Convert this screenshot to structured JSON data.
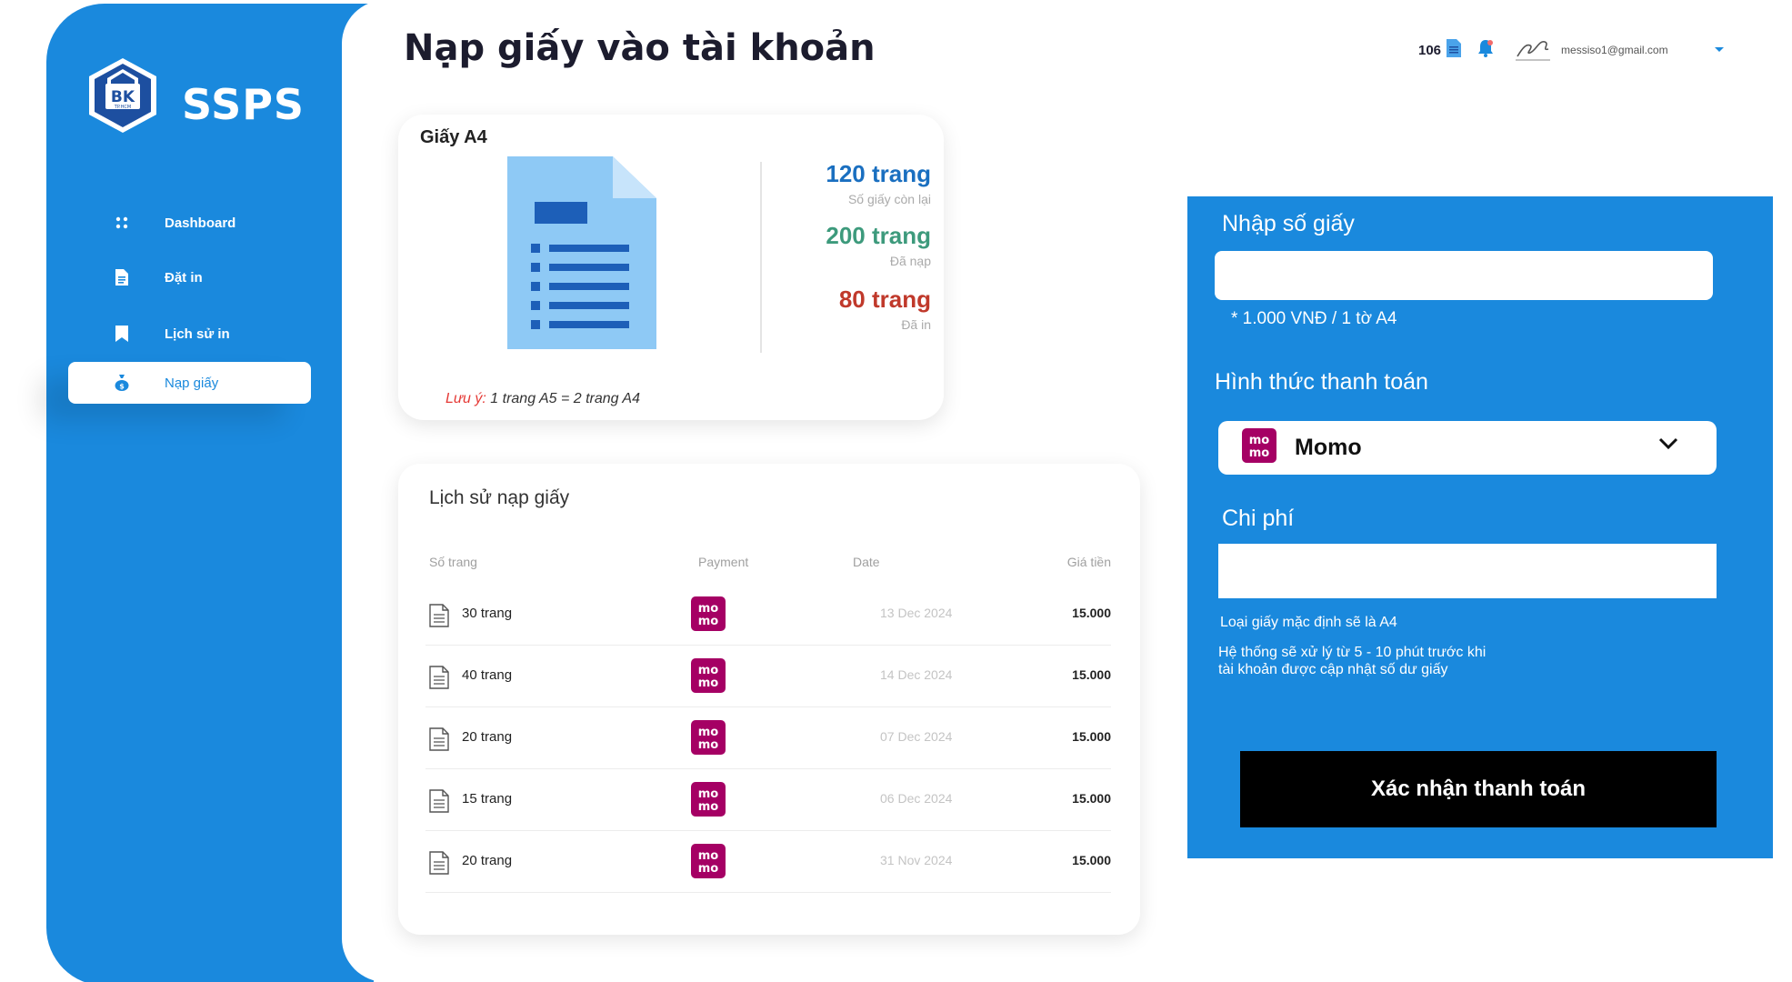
{
  "sidebar": {
    "brand": "SSPS",
    "logo_text": "BK",
    "logo_subtext": "TP.HCM",
    "items": [
      {
        "label": "Dashboard",
        "icon": "grid-icon"
      },
      {
        "label": "Đặt in",
        "icon": "document-icon"
      },
      {
        "label": "Lịch sử in",
        "icon": "bookmark-icon"
      },
      {
        "label": "Nạp giấy",
        "icon": "money-bag-icon",
        "active": true
      }
    ]
  },
  "header": {
    "title": "Nạp giấy vào tài khoản",
    "page_count": "106",
    "email": "messiso1@gmail.com"
  },
  "paper_card": {
    "title": "Giấy A4",
    "stats": [
      {
        "value": "120 trang",
        "caption": "Số giấy còn lại",
        "color": "#1a6fc0"
      },
      {
        "value": "200 trang",
        "caption": "Đã nạp",
        "color": "#3d9a7c"
      },
      {
        "value": "80 trang",
        "caption": "Đã in",
        "color": "#c0392b"
      }
    ],
    "note_label": "Lưu ý:",
    "note_text": " 1 trang A5 = 2 trang A4"
  },
  "history": {
    "title": "Lịch sử nạp giấy",
    "columns": {
      "pages": "Số trang",
      "payment": "Payment",
      "date": "Date",
      "price": "Giá tiền"
    },
    "rows": [
      {
        "pages": "30 trang",
        "payment": "momo",
        "date": "13 Dec 2024",
        "price": "15.000"
      },
      {
        "pages": "40 trang",
        "payment": "momo",
        "date": "14 Dec 2024",
        "price": "15.000"
      },
      {
        "pages": "20 trang",
        "payment": "momo",
        "date": "07 Dec 2024",
        "price": "15.000"
      },
      {
        "pages": "15 trang",
        "payment": "momo",
        "date": "06 Dec 2024",
        "price": "15.000"
      },
      {
        "pages": "20 trang",
        "payment": "momo",
        "date": "31 Nov 2024",
        "price": "15.000"
      }
    ]
  },
  "payment_panel": {
    "quantity_label": "Nhập số giấy",
    "quantity_value": "",
    "rate": "* 1.000 VNĐ / 1 tờ A4",
    "method_label": "Hình thức thanh toán",
    "method_value": "Momo",
    "cost_label": "Chi phí",
    "cost_value": "",
    "info_default": "Loại giấy mặc định sẽ là A4",
    "info_processing": "Hệ thống sẽ xử lý từ 5 - 10 phút trước khi tài khoản được cập nhật số dư giấy",
    "confirm_label": "Xác nhận thanh toán"
  },
  "colors": {
    "primary": "#1a89dd",
    "momo": "#a50064",
    "dark": "#000000"
  }
}
